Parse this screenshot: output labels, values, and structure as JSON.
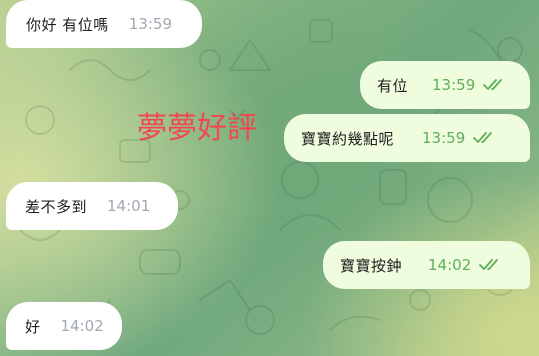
{
  "messages": [
    {
      "direction": "incoming",
      "text": "你好 有位嗎",
      "time": "13:59"
    },
    {
      "direction": "outgoing",
      "text": "有位",
      "time": "13:59",
      "status": "read"
    },
    {
      "direction": "outgoing",
      "text": "寶寶約幾點呢",
      "time": "13:59",
      "status": "read"
    },
    {
      "direction": "incoming",
      "text": "差不多到",
      "time": "14:01"
    },
    {
      "direction": "outgoing",
      "text": "寶寶按鈡",
      "time": "14:02",
      "status": "read"
    },
    {
      "direction": "incoming",
      "text": "好",
      "time": "14:02"
    }
  ],
  "overlay": {
    "text": "夢夢好評",
    "color": "#f2474e"
  },
  "colors": {
    "incoming_bubble": "#ffffff",
    "outgoing_bubble": "#effdde",
    "outgoing_time": "#5eae5a",
    "incoming_time": "#a0a8b2"
  },
  "icons": {
    "read_status": "double-check-icon"
  }
}
